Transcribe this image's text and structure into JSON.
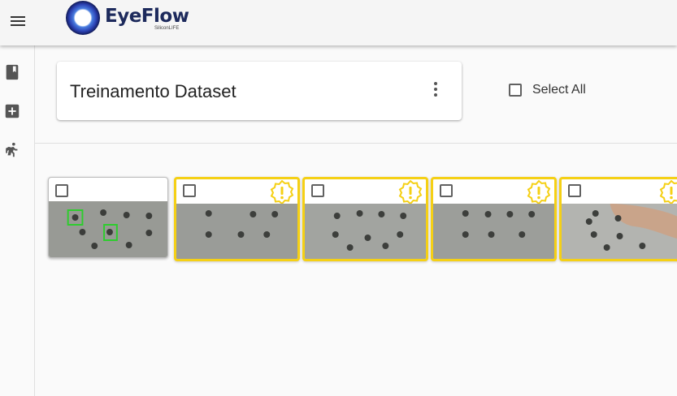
{
  "app": {
    "logo_text": "EyeFlow",
    "logo_subtext": "SiliconLIFE"
  },
  "topbar": {
    "menu_icon": "hamburger-menu-icon"
  },
  "sidebar": {
    "items": [
      {
        "icon": "book-icon"
      },
      {
        "icon": "add-box-icon"
      },
      {
        "icon": "running-person-icon"
      }
    ]
  },
  "dataset": {
    "title": "Treinamento Dataset",
    "menu_icon": "more-vertical-icon"
  },
  "select_all": {
    "label": "Select All",
    "checked": false
  },
  "colors": {
    "warning_border": "#f5d015",
    "detection_box": "#2ecc2e",
    "brand_blue": "#1d2a5c"
  },
  "gallery": {
    "images": [
      {
        "status": "annotated",
        "checked": false,
        "detections": 2
      },
      {
        "status": "warning",
        "checked": false,
        "warning_icon": "alert-badge-icon"
      },
      {
        "status": "warning",
        "checked": false,
        "warning_icon": "alert-badge-icon"
      },
      {
        "status": "warning",
        "checked": false,
        "warning_icon": "alert-badge-icon"
      },
      {
        "status": "warning",
        "checked": false,
        "warning_icon": "alert-badge-icon"
      }
    ]
  }
}
